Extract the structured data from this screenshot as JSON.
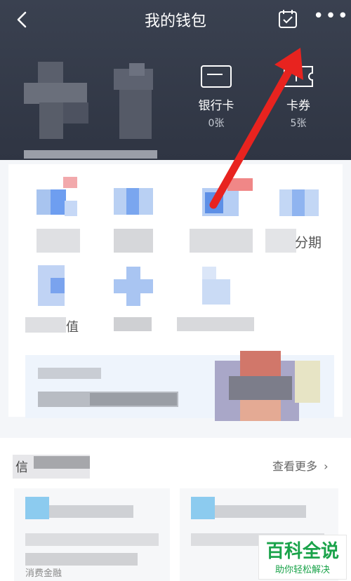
{
  "nav": {
    "title": "我的钱包"
  },
  "assets": [
    {
      "label": "银行卡",
      "value": "0张"
    },
    {
      "label": "卡券",
      "value": "5张"
    }
  ],
  "grid_partial": {
    "row2_col4": "分期",
    "row3_col1": "值"
  },
  "recommend": {
    "title": "信",
    "see_more": "查看更多"
  },
  "finance": {
    "label": "消费金融"
  },
  "watermark": {
    "brand": "百科全说",
    "slogan": "助你轻松解决"
  },
  "colors": {
    "header_bg": "#363c4a",
    "arrow": "#e8231f",
    "accent_blue": "#5b8fe8",
    "brand_green": "#1aa34a"
  },
  "icons": [
    "back-icon",
    "calendar-check-icon",
    "more-icon",
    "bank-card-icon",
    "coupon-icon",
    "chevron-right-icon"
  ]
}
